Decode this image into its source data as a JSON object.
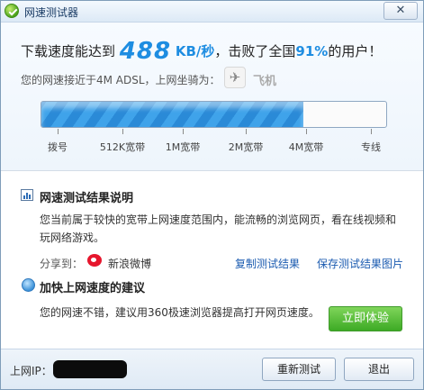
{
  "window": {
    "title": "网速测试器",
    "close_glyph": "✕"
  },
  "result": {
    "prefix": "下载速度能达到",
    "speed": "488",
    "unit": "KB/秒",
    "middle": "，击败了全国",
    "percent": "91%",
    "suffix": "的用户！",
    "comparison": "您的网速接近于4M ADSL，上网坐骑为：",
    "vehicle_icon": "airplane-icon",
    "vehicle_label": "飞机"
  },
  "speed_bar": {
    "fill_fraction": 0.76,
    "fill_color": "#2a8ad7",
    "ticks": [
      "拨号",
      "512K宽带",
      "1M宽带",
      "2M宽带",
      "4M宽带",
      "专线"
    ]
  },
  "explanation": {
    "title": "网速测试结果说明",
    "text": "您当前属于较快的宽带上网速度范围内，能流畅的浏览网页，看在线视频和玩网络游戏。",
    "share_label": "分享到：",
    "share_target": "新浪微博",
    "copy_link": "复制测试结果",
    "save_link": "保存测试结果图片"
  },
  "suggestion": {
    "title": "加快上网速度的建议",
    "text": "您的网速不错，建议用360极速浏览器提高打开网页速度。",
    "button": "立即体验"
  },
  "footer": {
    "ip_label": "上网IP：",
    "retest_button": "重新测试",
    "exit_button": "退出"
  }
}
